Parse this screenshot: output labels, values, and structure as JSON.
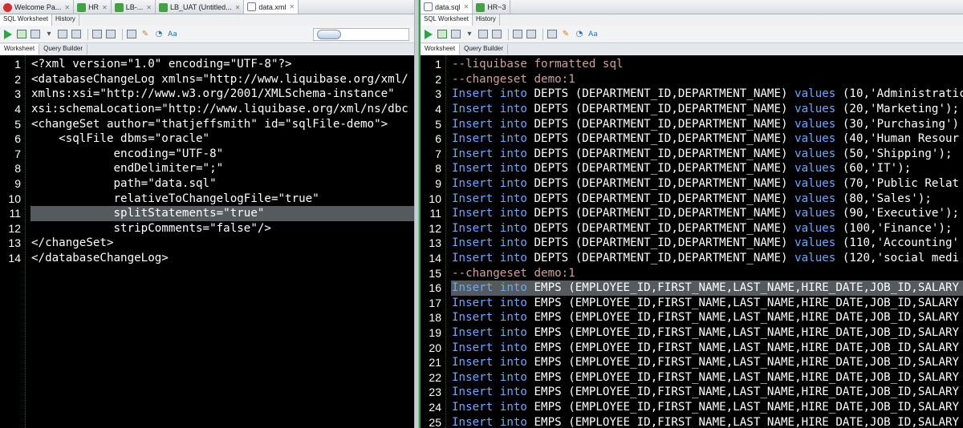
{
  "left": {
    "tabs": [
      {
        "label": "Welcome Pa...",
        "icon": "oracle-icon"
      },
      {
        "label": "HR",
        "icon": "sql-worksheet-icon"
      },
      {
        "label": "LB-...",
        "icon": "sql-worksheet-icon"
      },
      {
        "label": "LB_UAT (Untitled...",
        "icon": "sql-worksheet-icon"
      },
      {
        "label": "data.xml",
        "icon": "xml-file-icon"
      }
    ],
    "subtabs": [
      "SQL Worksheet",
      "History"
    ],
    "worksheet_tabs": [
      "Worksheet",
      "Query Builder"
    ],
    "lines": [
      {
        "n": "1",
        "text": "<?xml version=\"1.0\" encoding=\"UTF-8\"?>"
      },
      {
        "n": "2",
        "text": "<databaseChangeLog xmlns=\"http://www.liquibase.org/xml/"
      },
      {
        "n": "3",
        "text": "xmlns:xsi=\"http://www.w3.org/2001/XMLSchema-instance\""
      },
      {
        "n": "4",
        "text": "xsi:schemaLocation=\"http://www.liquibase.org/xml/ns/dbc"
      },
      {
        "n": "5",
        "text": "<changeSet author=\"thatjeffsmith\" id=\"sqlFile-demo\">"
      },
      {
        "n": "6",
        "text": "    <sqlFile dbms=\"oracle\""
      },
      {
        "n": "7",
        "text": "            encoding=\"UTF-8\""
      },
      {
        "n": "8",
        "text": "            endDelimiter=\";\""
      },
      {
        "n": "9",
        "text": "            path=\"data.sql\""
      },
      {
        "n": "10",
        "text": "            relativeToChangelogFile=\"true\""
      },
      {
        "n": "11",
        "text": "            splitStatements=\"true\""
      },
      {
        "n": "12",
        "text": "            stripComments=\"false\"/>"
      },
      {
        "n": "13",
        "text": "</changeSet>"
      },
      {
        "n": "14",
        "text": "</databaseChangeLog>"
      }
    ],
    "highlighted_line": 11
  },
  "right": {
    "tabs": [
      {
        "label": "data.sql",
        "icon": "sql-file-icon"
      },
      {
        "label": "HR~3",
        "icon": "sql-worksheet-icon"
      }
    ],
    "subtabs": [
      "SQL Worksheet",
      "History"
    ],
    "worksheet_tabs": [
      "Worksheet",
      "Query Builder"
    ],
    "lines": [
      {
        "n": "1",
        "text": "--liquibase formatted sql"
      },
      {
        "n": "2",
        "text": "--changeset demo:1"
      },
      {
        "n": "3",
        "text": "Insert into DEPTS (DEPARTMENT_ID,DEPARTMENT_NAME) values (10,'Administratic"
      },
      {
        "n": "4",
        "text": "Insert into DEPTS (DEPARTMENT_ID,DEPARTMENT_NAME) values (20,'Marketing');"
      },
      {
        "n": "5",
        "text": "Insert into DEPTS (DEPARTMENT_ID,DEPARTMENT_NAME) values (30,'Purchasing')"
      },
      {
        "n": "6",
        "text": "Insert into DEPTS (DEPARTMENT_ID,DEPARTMENT_NAME) values (40,'Human Resour"
      },
      {
        "n": "7",
        "text": "Insert into DEPTS (DEPARTMENT_ID,DEPARTMENT_NAME) values (50,'Shipping');"
      },
      {
        "n": "8",
        "text": "Insert into DEPTS (DEPARTMENT_ID,DEPARTMENT_NAME) values (60,'IT');"
      },
      {
        "n": "9",
        "text": "Insert into DEPTS (DEPARTMENT_ID,DEPARTMENT_NAME) values (70,'Public Relat"
      },
      {
        "n": "10",
        "text": "Insert into DEPTS (DEPARTMENT_ID,DEPARTMENT_NAME) values (80,'Sales');"
      },
      {
        "n": "11",
        "text": "Insert into DEPTS (DEPARTMENT_ID,DEPARTMENT_NAME) values (90,'Executive');"
      },
      {
        "n": "12",
        "text": "Insert into DEPTS (DEPARTMENT_ID,DEPARTMENT_NAME) values (100,'Finance');"
      },
      {
        "n": "13",
        "text": "Insert into DEPTS (DEPARTMENT_ID,DEPARTMENT_NAME) values (110,'Accounting'"
      },
      {
        "n": "14",
        "text": "Insert into DEPTS (DEPARTMENT_ID,DEPARTMENT_NAME) values (120,'social medi"
      },
      {
        "n": "15",
        "text": "--changeset demo:1"
      },
      {
        "n": "16",
        "text": "Insert into EMPS (EMPLOYEE_ID,FIRST_NAME,LAST_NAME,HIRE_DATE,JOB_ID,SALARY"
      },
      {
        "n": "17",
        "text": "Insert into EMPS (EMPLOYEE_ID,FIRST_NAME,LAST_NAME,HIRE_DATE,JOB_ID,SALARY"
      },
      {
        "n": "18",
        "text": "Insert into EMPS (EMPLOYEE_ID,FIRST_NAME,LAST_NAME,HIRE_DATE,JOB_ID,SALARY"
      },
      {
        "n": "19",
        "text": "Insert into EMPS (EMPLOYEE_ID,FIRST_NAME,LAST_NAME,HIRE_DATE,JOB_ID,SALARY"
      },
      {
        "n": "20",
        "text": "Insert into EMPS (EMPLOYEE_ID,FIRST_NAME,LAST_NAME,HIRE_DATE,JOB_ID,SALARY"
      },
      {
        "n": "21",
        "text": "Insert into EMPS (EMPLOYEE_ID,FIRST_NAME,LAST_NAME,HIRE_DATE,JOB_ID,SALARY"
      },
      {
        "n": "22",
        "text": "Insert into EMPS (EMPLOYEE_ID,FIRST_NAME,LAST_NAME,HIRE_DATE,JOB_ID,SALARY"
      },
      {
        "n": "23",
        "text": "Insert into EMPS (EMPLOYEE_ID,FIRST_NAME,LAST_NAME,HIRE_DATE,JOB_ID,SALARY"
      },
      {
        "n": "24",
        "text": "Insert into EMPS (EMPLOYEE_ID,FIRST_NAME,LAST_NAME,HIRE_DATE,JOB_ID,SALARY"
      },
      {
        "n": "25",
        "text": "Insert into EMPS (EMPLOYEE_ID,FIRST_NAME,LAST_NAME,HIRE_DATE,JOB_ID,SALARY"
      }
    ],
    "highlighted_line": 16
  },
  "colors": {
    "editor_bg": "#000000",
    "sql_keyword": "#6aa9ff",
    "comment": "#d0a0a0",
    "current_line": "#555a5f",
    "active_border": "#2f9e44"
  }
}
